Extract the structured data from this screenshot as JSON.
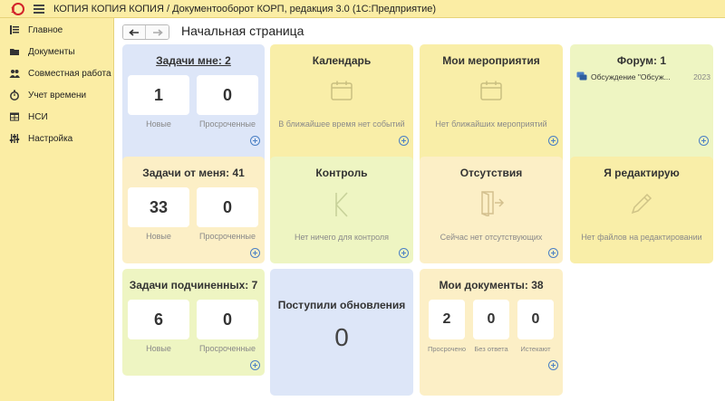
{
  "window": {
    "title": "КОПИЯ КОПИЯ КОПИЯ / Документооборот КОРП, редакция 3.0  (1С:Предприятие)"
  },
  "sidebar": {
    "items": [
      {
        "label": "Главное",
        "icon": "list-icon"
      },
      {
        "label": "Документы",
        "icon": "folder-icon"
      },
      {
        "label": "Совместная работа",
        "icon": "people-icon"
      },
      {
        "label": "Учет времени",
        "icon": "stopwatch-icon"
      },
      {
        "label": "НСИ",
        "icon": "table-icon"
      },
      {
        "label": "Настройка",
        "icon": "sliders-icon"
      }
    ]
  },
  "header": {
    "page_title": "Начальная страница"
  },
  "tiles": {
    "tasks_to_me": {
      "title": "Задачи мне: 2",
      "new_count": "1",
      "new_label": "Новые",
      "overdue_count": "0",
      "overdue_label": "Просроченные"
    },
    "calendar": {
      "title": "Календарь",
      "empty": "В ближайшее время нет событий"
    },
    "my_events": {
      "title": "Мои мероприятия",
      "empty": "Нет ближайших мероприятий"
    },
    "forum": {
      "title": "Форум: 1",
      "item_text": "Обсуждение \"Обсуж...",
      "item_year": "2023"
    },
    "tasks_from_me": {
      "title": "Задачи от меня: 41",
      "new_count": "33",
      "new_label": "Новые",
      "overdue_count": "0",
      "overdue_label": "Просроченные"
    },
    "control": {
      "title": "Контроль",
      "empty": "Нет ничего для контроля"
    },
    "absence": {
      "title": "Отсутствия",
      "empty": "Сейчас нет отсутствующих"
    },
    "editing": {
      "title": "Я редактирую",
      "empty": "Нет файлов на редактировании"
    },
    "subordinate_tasks": {
      "title": "Задачи подчиненных: 7",
      "new_count": "6",
      "new_label": "Новые",
      "overdue_count": "0",
      "overdue_label": "Просроченные"
    },
    "updates": {
      "title": "Поступили обновления",
      "count": "0"
    },
    "my_documents": {
      "title": "Мои документы: 38",
      "overdue_count": "2",
      "overdue_label": "Просрочено",
      "no_answer_count": "0",
      "no_answer_label": "Без ответа",
      "expiring_count": "0",
      "expiring_label": "Истекают"
    }
  },
  "colors": {
    "panel": "#fbeda4",
    "blue_tile": "#dde6f8",
    "yellow_tile": "#f9eea8",
    "green_tile": "#eef5c2",
    "orange_tile": "#fcefc6",
    "accent": "#4a7fc4"
  }
}
